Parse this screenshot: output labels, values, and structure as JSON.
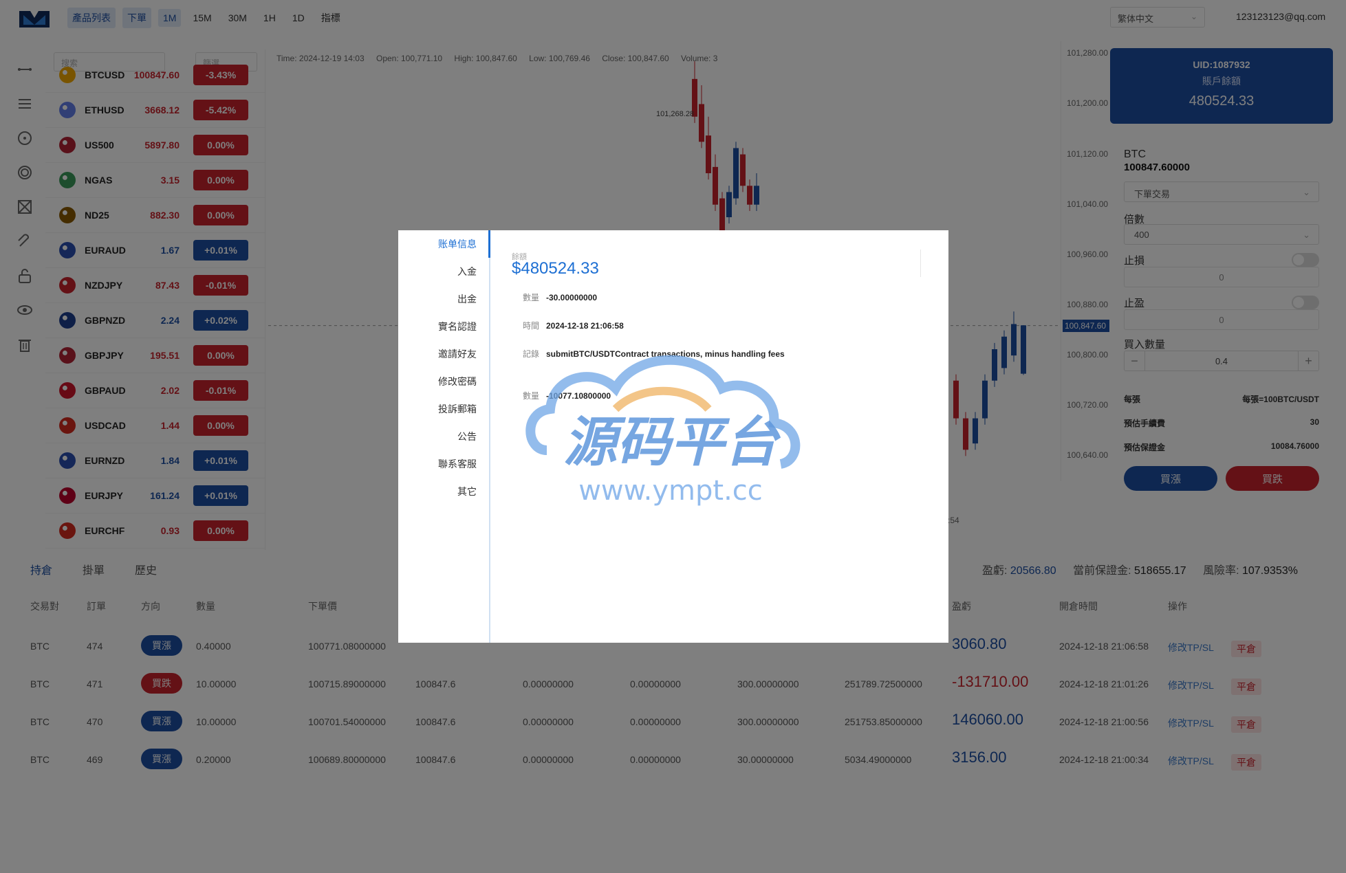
{
  "header": {
    "nav": [
      {
        "label": "產品列表",
        "active": true
      },
      {
        "label": "下單",
        "active": true
      },
      {
        "label": "1M",
        "active": true
      },
      {
        "label": "15M",
        "active": false
      },
      {
        "label": "30M",
        "active": false
      },
      {
        "label": "1H",
        "active": false
      },
      {
        "label": "1D",
        "active": false
      },
      {
        "label": "指標",
        "active": false
      }
    ],
    "language": "繁体中文",
    "user_email": "123123123@qq.com"
  },
  "sidebar_icons": [
    "crosshair-icon",
    "lines-icon",
    "circle-icon",
    "target-icon",
    "network-icon",
    "magnet-icon",
    "lock-icon",
    "eye-icon",
    "trash-icon"
  ],
  "product_list": {
    "search_placeholder": "搜索",
    "filter_label": "篩選",
    "items": [
      {
        "symbol": "BTCUSD",
        "price": "100847.60",
        "change": "-3.43%",
        "direction": "down"
      },
      {
        "symbol": "ETHUSD",
        "price": "3668.12",
        "change": "-5.42%",
        "direction": "down"
      },
      {
        "symbol": "US500",
        "price": "5897.80",
        "change": "0.00%",
        "direction": "down"
      },
      {
        "symbol": "NGAS",
        "price": "3.15",
        "change": "0.00%",
        "direction": "down"
      },
      {
        "symbol": "ND25",
        "price": "882.30",
        "change": "0.00%",
        "direction": "down"
      },
      {
        "symbol": "EURAUD",
        "price": "1.67",
        "change": "+0.01%",
        "direction": "up"
      },
      {
        "symbol": "NZDJPY",
        "price": "87.43",
        "change": "-0.01%",
        "direction": "down"
      },
      {
        "symbol": "GBPNZD",
        "price": "2.24",
        "change": "+0.02%",
        "direction": "up"
      },
      {
        "symbol": "GBPJPY",
        "price": "195.51",
        "change": "0.00%",
        "direction": "down"
      },
      {
        "symbol": "GBPAUD",
        "price": "2.02",
        "change": "-0.01%",
        "direction": "down"
      },
      {
        "symbol": "USDCAD",
        "price": "1.44",
        "change": "0.00%",
        "direction": "down"
      },
      {
        "symbol": "EURNZD",
        "price": "1.84",
        "change": "+0.01%",
        "direction": "up"
      },
      {
        "symbol": "EURJPY",
        "price": "161.24",
        "change": "+0.01%",
        "direction": "up"
      },
      {
        "symbol": "EURCHF",
        "price": "0.93",
        "change": "0.00%",
        "direction": "down"
      }
    ]
  },
  "chart": {
    "info": {
      "time": "Time: 2024-12-19 14:03",
      "open": "Open: 100,771.10",
      "high": "High: 100,847.60",
      "low": "Low: 100,769.46",
      "close": "Close: 100,847.60",
      "volume": "Volume: 3"
    },
    "y_ticks": [
      "101,280.00",
      "101,200.00",
      "101,120.00",
      "101,040.00",
      "100,960.00",
      "100,880.00",
      "100,800.00",
      "100,720.00",
      "100,640.00"
    ],
    "last_price_label": "100,847.60",
    "high_marker": "101,268.28",
    "x_label_partial": ":54"
  },
  "chart_data": {
    "type": "candlestick",
    "ylim": [
      100600,
      101300
    ],
    "last_price": 100847.6,
    "candles": [
      {
        "o": 101240,
        "c": 101180,
        "h": 101268,
        "l": 101170
      },
      {
        "o": 101200,
        "c": 101140,
        "h": 101230,
        "l": 101130
      },
      {
        "o": 101150,
        "c": 101090,
        "h": 101180,
        "l": 101080
      },
      {
        "o": 101100,
        "c": 101040,
        "h": 101120,
        "l": 101030
      },
      {
        "o": 101050,
        "c": 100980,
        "h": 101060,
        "l": 100970
      },
      {
        "o": 101020,
        "c": 101060,
        "h": 101070,
        "l": 101010
      },
      {
        "o": 101050,
        "c": 101130,
        "h": 101140,
        "l": 101040
      },
      {
        "o": 101120,
        "c": 101070,
        "h": 101130,
        "l": 101060
      },
      {
        "o": 101070,
        "c": 101040,
        "h": 101080,
        "l": 101030
      },
      {
        "o": 101040,
        "c": 101070,
        "h": 101090,
        "l": 101030
      },
      {
        "o": 100760,
        "c": 100700,
        "h": 100770,
        "l": 100690
      },
      {
        "o": 100700,
        "c": 100650,
        "h": 100710,
        "l": 100640
      },
      {
        "o": 100660,
        "c": 100700,
        "h": 100710,
        "l": 100650
      },
      {
        "o": 100700,
        "c": 100760,
        "h": 100770,
        "l": 100690
      },
      {
        "o": 100760,
        "c": 100810,
        "h": 100820,
        "l": 100750
      },
      {
        "o": 100780,
        "c": 100830,
        "h": 100840,
        "l": 100770
      },
      {
        "o": 100800,
        "c": 100850,
        "h": 100870,
        "l": 100790
      },
      {
        "o": 100771,
        "c": 100848,
        "h": 100848,
        "l": 100769
      }
    ]
  },
  "right_panel": {
    "uid": "UID:1087932",
    "balance_label": "賬戶餘額",
    "balance": "480524.33",
    "symbol": "BTC",
    "price": "100847.60000",
    "order_type": "下單交易",
    "leverage_label": "倍數",
    "leverage": "400",
    "stop_loss_label": "止損",
    "stop_loss_value": "0",
    "take_profit_label": "止盈",
    "take_profit_value": "0",
    "qty_label": "買入數量",
    "qty": "0.4",
    "per_lot_label": "每張",
    "per_lot_value": "每張=100BTC/USDT",
    "fee_label": "預估手續費",
    "fee_value": "30",
    "margin_label": "預估保證金",
    "margin_value": "10084.76000",
    "buy_label": "買漲",
    "sell_label": "買跌"
  },
  "positions": {
    "tabs": [
      "持倉",
      "掛單",
      "歷史"
    ],
    "summary": {
      "pnl_label": "盈虧:",
      "pnl": "20566.80",
      "margin_label": "當前保證金:",
      "margin": "518655.17",
      "risk_label": "風險率:",
      "risk": "107.9353%"
    },
    "headers": [
      "交易對",
      "訂單",
      "方向",
      "數量",
      "下單價",
      "",
      "",
      "",
      "",
      "",
      "盈虧",
      "開倉時間",
      "操作"
    ],
    "rows": [
      {
        "pair": "BTC",
        "order": "474",
        "dir": "買漲",
        "dir_type": "up",
        "qty": "0.40000",
        "entry": "100771.08000000",
        "cur": "",
        "sl": "",
        "tp": "",
        "fee": "",
        "margin": "",
        "pnl": "3060.80",
        "pnl_type": "up",
        "time": "2024-12-18 21:06:58",
        "edit": "修改TP/SL",
        "close": "平倉"
      },
      {
        "pair": "BTC",
        "order": "471",
        "dir": "買跌",
        "dir_type": "down",
        "qty": "10.00000",
        "entry": "100715.89000000",
        "cur": "100847.6",
        "sl": "0.00000000",
        "tp": "0.00000000",
        "fee": "300.00000000",
        "margin": "251789.72500000",
        "pnl": "-131710.00",
        "pnl_type": "down",
        "time": "2024-12-18 21:01:26",
        "edit": "修改TP/SL",
        "close": "平倉"
      },
      {
        "pair": "BTC",
        "order": "470",
        "dir": "買漲",
        "dir_type": "up",
        "qty": "10.00000",
        "entry": "100701.54000000",
        "cur": "100847.6",
        "sl": "0.00000000",
        "tp": "0.00000000",
        "fee": "300.00000000",
        "margin": "251753.85000000",
        "pnl": "146060.00",
        "pnl_type": "up",
        "time": "2024-12-18 21:00:56",
        "edit": "修改TP/SL",
        "close": "平倉"
      },
      {
        "pair": "BTC",
        "order": "469",
        "dir": "買漲",
        "dir_type": "up",
        "qty": "0.20000",
        "entry": "100689.80000000",
        "cur": "100847.6",
        "sl": "0.00000000",
        "tp": "0.00000000",
        "fee": "30.00000000",
        "margin": "5034.49000000",
        "pnl": "3156.00",
        "pnl_type": "up",
        "time": "2024-12-18 21:00:34",
        "edit": "修改TP/SL",
        "close": "平倉"
      }
    ]
  },
  "modal": {
    "menu": [
      {
        "label": "账单信息",
        "active": true
      },
      {
        "label": "入金",
        "active": false
      },
      {
        "label": "出金",
        "active": false
      },
      {
        "label": "實名認證",
        "active": false
      },
      {
        "label": "邀請好友",
        "active": false
      },
      {
        "label": "修改密碼",
        "active": false
      },
      {
        "label": "投訴郵箱",
        "active": false
      },
      {
        "label": "公告",
        "active": false
      },
      {
        "label": "聯系客服",
        "active": false
      },
      {
        "label": "其它",
        "active": false
      }
    ],
    "balance_label": "餘額",
    "balance": "$480524.33",
    "records": [
      {
        "key": "數量",
        "value": "-30.00000000"
      },
      {
        "key": "時間",
        "value": "2024-12-18 21:06:58"
      },
      {
        "key": "記錄",
        "value": "submitBTC/USDTContract transactions, minus handling fees"
      },
      {
        "key": "數量",
        "value": "-10077.10800000"
      }
    ]
  },
  "watermark": {
    "title": "源码平台",
    "url": "www.ympt.cc"
  },
  "colors": {
    "accent": "#1d4ea3",
    "up": "#1d4ea3",
    "down": "#c8232c",
    "modal_accent": "#1d6fd3"
  }
}
